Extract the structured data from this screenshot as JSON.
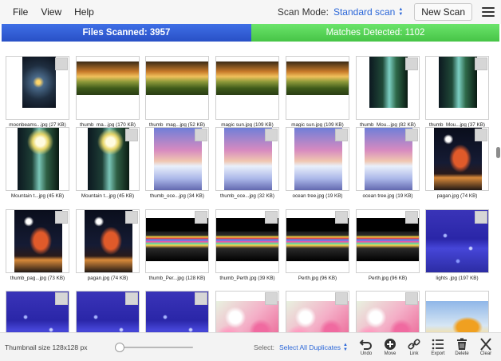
{
  "menu": {
    "file": "File",
    "view": "View",
    "help": "Help"
  },
  "toolbar": {
    "scan_mode_label": "Scan Mode:",
    "scan_mode_value": "Standard scan",
    "new_scan": "New Scan",
    "menu_icon": "hamburger-icon"
  },
  "status": {
    "files_scanned": "Files Scanned: 3957",
    "matches_detected": "Matches Detected: 1102",
    "colors": {
      "scanned": "#2f5bd8",
      "matches": "#56d356"
    }
  },
  "grid": {
    "rows": [
      [
        {
          "caption": "moonbeams...jpg (27 KB)",
          "image": "moon",
          "checkbox": true
        },
        {
          "caption": "thumb_ma...jpg (170 KB)",
          "image": "sunset",
          "checkbox": false
        },
        {
          "caption": "thumb_mag...jpg (52 KB)",
          "image": "sunset",
          "checkbox": false
        },
        {
          "caption": "magic sun.jpg (109 KB)",
          "image": "sunset",
          "checkbox": false
        },
        {
          "caption": "magic sun.jpg (109 KB)",
          "image": "sunset",
          "checkbox": false
        },
        {
          "caption": "thumb_Mou...jpg (82 KB)",
          "image": "fall",
          "checkbox": true
        },
        {
          "caption": "thumb_Mou...jpg (37 KB)",
          "image": "fall",
          "checkbox": true
        }
      ],
      [
        {
          "caption": "Mountain t...jpg (45 KB)",
          "image": "fallmoon",
          "checkbox": false
        },
        {
          "caption": "Mountain t...jpg (45 KB)",
          "image": "fallmoon",
          "checkbox": true
        },
        {
          "caption": "thumb_oce...jpg (34 KB)",
          "image": "ocean",
          "checkbox": true
        },
        {
          "caption": "thumb_oce...jpg (32 KB)",
          "image": "ocean",
          "checkbox": true
        },
        {
          "caption": "ocean tree.jpg (19 KB)",
          "image": "ocean",
          "checkbox": true
        },
        {
          "caption": "ocean tree.jpg (19 KB)",
          "image": "ocean",
          "checkbox": true
        },
        {
          "caption": "pagan.jpg (74 KB)",
          "image": "pagan",
          "checkbox": true
        }
      ],
      [
        {
          "caption": "thumb_pag...jpg (73 KB)",
          "image": "pagan",
          "checkbox": true
        },
        {
          "caption": "pagan.jpg (74 KB)",
          "image": "pagan",
          "checkbox": true
        },
        {
          "caption": "thumb_Per...jpg (128 KB)",
          "image": "city",
          "checkbox": true
        },
        {
          "caption": "thumb_Perth.jpg (39 KB)",
          "image": "city",
          "checkbox": true
        },
        {
          "caption": "Perth.jpg (96 KB)",
          "image": "city",
          "checkbox": true
        },
        {
          "caption": "Perth.jpg (96 KB)",
          "image": "city",
          "checkbox": true
        },
        {
          "caption": "lights .jpg (197 KB)",
          "image": "lights",
          "checkbox": true
        }
      ],
      [
        {
          "caption": "",
          "image": "lights",
          "checkbox": true
        },
        {
          "caption": "",
          "image": "lights",
          "checkbox": true
        },
        {
          "caption": "",
          "image": "lights",
          "checkbox": true
        },
        {
          "caption": "",
          "image": "blossom",
          "checkbox": true
        },
        {
          "caption": "",
          "image": "blossom",
          "checkbox": true
        },
        {
          "caption": "",
          "image": "blossom",
          "checkbox": true
        },
        {
          "caption": "",
          "image": "tree",
          "checkbox": false
        }
      ]
    ]
  },
  "bottom": {
    "thumbnail_size": "Thumbnail size 128x128 px",
    "select_label": "Select:",
    "select_value": "Select All Duplicates",
    "tools": [
      {
        "label": "Undo",
        "icon": "undo-icon"
      },
      {
        "label": "Move",
        "icon": "move-icon"
      },
      {
        "label": "Link",
        "icon": "link-icon"
      },
      {
        "label": "Export",
        "icon": "export-icon"
      },
      {
        "label": "Delete",
        "icon": "trash-icon"
      },
      {
        "label": "Clear",
        "icon": "close-icon"
      }
    ]
  }
}
